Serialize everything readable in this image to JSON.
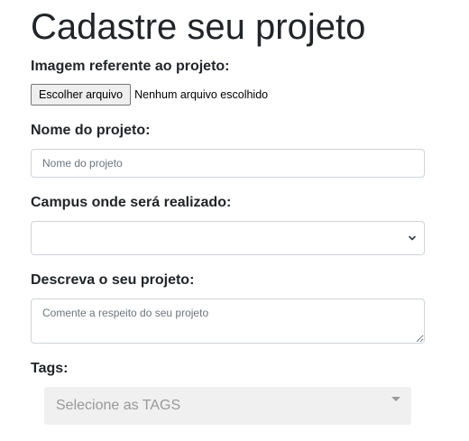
{
  "page": {
    "title": "Cadastre seu projeto"
  },
  "image_field": {
    "label": "Imagem referente ao projeto:",
    "button_label": "Escolher arquivo",
    "status_text": "Nenhum arquivo escolhido"
  },
  "name_field": {
    "label": "Nome do projeto:",
    "placeholder": "Nome do projeto",
    "value": ""
  },
  "campus_field": {
    "label": "Campus onde será realizado:",
    "selected_value": "",
    "icon": "chevron-down-icon"
  },
  "description_field": {
    "label": "Descreva o seu projeto:",
    "placeholder": "Comente a respeito do seu projeto",
    "value": ""
  },
  "tags_field": {
    "label": "Tags:",
    "placeholder": "Selecione as TAGS",
    "icon": "caret-down-icon"
  },
  "colors": {
    "text": "#212529",
    "input_border": "#ced4da",
    "tags_background": "#f0f0f0",
    "tags_placeholder": "#999999"
  }
}
